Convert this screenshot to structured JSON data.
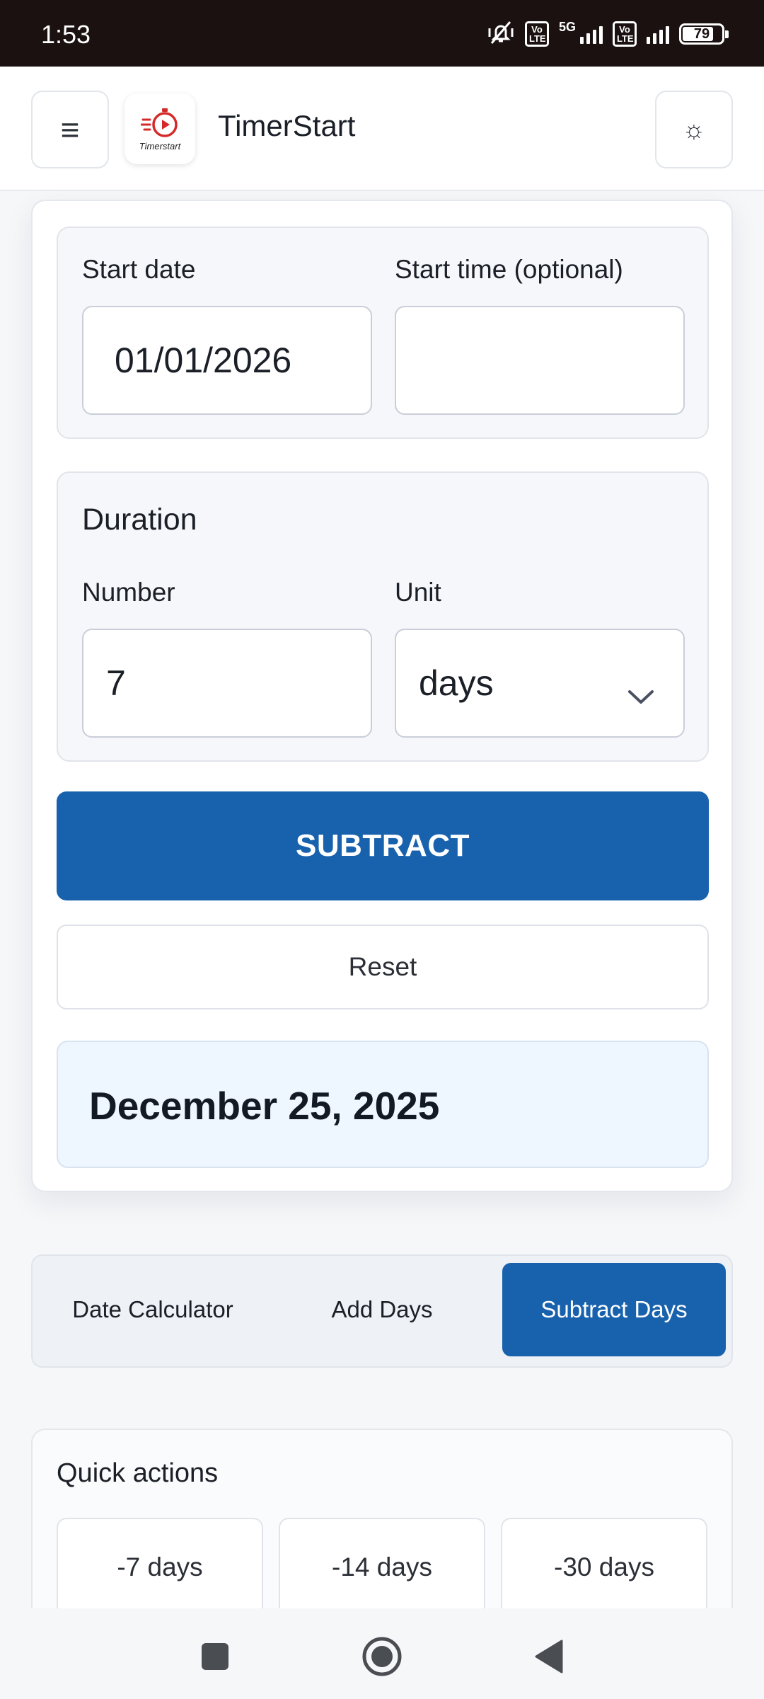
{
  "status_bar": {
    "time": "1:53",
    "network": "5G",
    "volte_label": "Vo LTE",
    "battery_level": "79",
    "icons": [
      "mute-vibrate-icon",
      "volte-icon",
      "signal-icon",
      "battery-icon"
    ]
  },
  "header": {
    "menu_icon": "≡",
    "logo_text": "Timerstart",
    "title": "TimerStart",
    "theme_icon": "☼"
  },
  "form": {
    "start_date_label": "Start date",
    "start_date_value": "01/01/2026",
    "start_time_label": "Start time (optional)",
    "start_time_value": "",
    "duration_title": "Duration",
    "number_label": "Number",
    "number_value": "7",
    "unit_label": "Unit",
    "unit_value": "days",
    "subtract_label": "SUBTRACT",
    "reset_label": "Reset",
    "result": "December 25, 2025"
  },
  "tabs": [
    {
      "label": "Date Calculator",
      "active": false
    },
    {
      "label": "Add Days",
      "active": false
    },
    {
      "label": "Subtract Days",
      "active": true
    }
  ],
  "quick_actions": {
    "title": "Quick actions",
    "items": [
      "-7 days",
      "-14 days",
      "-30 days"
    ]
  },
  "colors": {
    "primary": "#1862ad",
    "result_bg": "#eef6ff",
    "status_bar_bg": "#1a1110",
    "logo_red": "#d42a2a"
  }
}
